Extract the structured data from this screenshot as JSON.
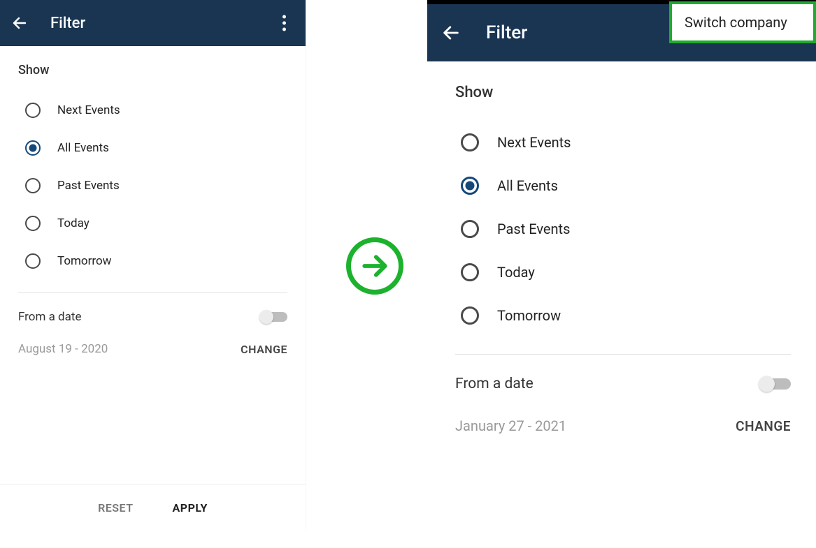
{
  "left": {
    "appbar": {
      "title": "Filter"
    },
    "show_heading": "Show",
    "options": [
      {
        "label": "Next Events",
        "selected": false
      },
      {
        "label": "All Events",
        "selected": true
      },
      {
        "label": "Past Events",
        "selected": false
      },
      {
        "label": "Today",
        "selected": false
      },
      {
        "label": "Tomorrow",
        "selected": false
      }
    ],
    "from_date_label": "From a date",
    "from_date_enabled": false,
    "date_value": "August 19 - 2020",
    "change_label": "CHANGE",
    "reset_label": "RESET",
    "apply_label": "APPLY"
  },
  "right": {
    "appbar": {
      "title": "Filter"
    },
    "menu_item": "Switch company",
    "show_heading": "Show",
    "options": [
      {
        "label": "Next Events",
        "selected": false
      },
      {
        "label": "All Events",
        "selected": true
      },
      {
        "label": "Past Events",
        "selected": false
      },
      {
        "label": "Today",
        "selected": false
      },
      {
        "label": "Tomorrow",
        "selected": false
      }
    ],
    "from_date_label": "From a date",
    "from_date_enabled": false,
    "date_value": "January 27 - 2021",
    "change_label": "CHANGE"
  },
  "transition_icon": "arrow-right"
}
